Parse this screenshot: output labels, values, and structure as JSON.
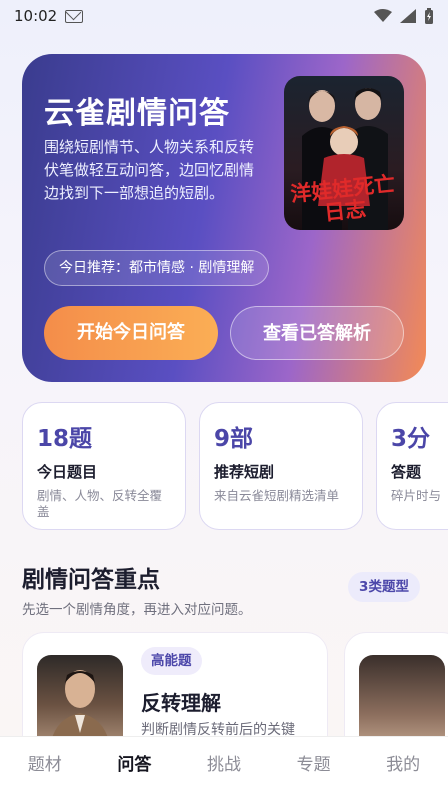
{
  "status_bar": {
    "time": "10:02"
  },
  "hero": {
    "title": "云雀剧情问答",
    "description": "围绕短剧情节、人物关系和反转伏笔做轻互动问答，边回忆剧情边找到下一部想追的短剧。",
    "recommend_chip": "今日推荐：都市情感 · 剧情理解",
    "poster_title": "洋娃娃死亡日志",
    "primary_button": "开始今日问答",
    "secondary_button": "查看已答解析"
  },
  "stats": [
    {
      "value": "18题",
      "label": "今日题目",
      "sub": "剧情、人物、反转全覆盖"
    },
    {
      "value": "9部",
      "label": "推荐短剧",
      "sub": "来自云雀短剧精选清单"
    },
    {
      "value": "3分",
      "label": "答题",
      "sub": "碎片时与"
    }
  ],
  "section": {
    "title": "剧情问答重点",
    "subtitle": "先选一个剧情角度，再进入对应问题。",
    "badge": "3类题型"
  },
  "cards": [
    {
      "tag": "高能题",
      "title": "反转理解",
      "desc": "判断剧情反转前后的关键"
    }
  ],
  "bottom_nav": [
    {
      "label": "题材",
      "active": false
    },
    {
      "label": "问答",
      "active": true
    },
    {
      "label": "挑战",
      "active": false
    },
    {
      "label": "专题",
      "active": false
    },
    {
      "label": "我的",
      "active": false
    }
  ],
  "colors": {
    "accent": "#4b46a8",
    "orange": "#f48d4a"
  }
}
